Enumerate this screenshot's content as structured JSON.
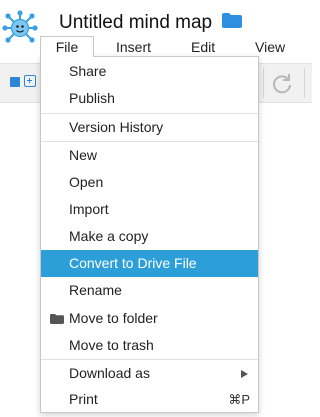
{
  "header": {
    "title": "Untitled mind map",
    "logo_icon": "mindmap-logo-icon",
    "folder_icon": "folder-icon"
  },
  "menubar": {
    "items": [
      "File",
      "Insert",
      "Edit",
      "View"
    ]
  },
  "colors": {
    "accent": "#2d9fd8",
    "folder": "#2e8fe0",
    "logo_blue": "#3aa0e6"
  },
  "file_menu": {
    "items": [
      {
        "label": "Share"
      },
      {
        "label": "Publish"
      },
      {
        "label": "Version History"
      },
      {
        "label": "New"
      },
      {
        "label": "Open"
      },
      {
        "label": "Import"
      },
      {
        "label": "Make a copy"
      },
      {
        "label": "Convert to Drive File",
        "selected": true
      },
      {
        "label": "Rename"
      },
      {
        "label": "Move to folder",
        "icon": "folder-icon"
      },
      {
        "label": "Move to trash"
      },
      {
        "label": "Download as",
        "submenu": true
      },
      {
        "label": "Print",
        "shortcut": "⌘P"
      }
    ]
  },
  "toolbar": {
    "icons": [
      "node-square-icon",
      "add-child-icon",
      "redo-icon"
    ]
  }
}
